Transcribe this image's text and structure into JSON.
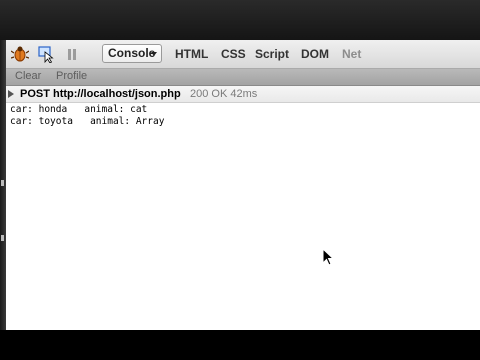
{
  "toolbar": {
    "icons": [
      "firebug-icon",
      "inspect-icon",
      "pause-icon"
    ],
    "console_label": "Console",
    "tabs": [
      {
        "label": "HTML",
        "enabled": true
      },
      {
        "label": "CSS",
        "enabled": true
      },
      {
        "label": "Script",
        "enabled": true
      },
      {
        "label": "DOM",
        "enabled": true
      },
      {
        "label": "Net",
        "enabled": false
      }
    ]
  },
  "subbar": {
    "clear_label": "Clear",
    "profile_label": "Profile"
  },
  "request": {
    "method": "POST",
    "url": "http://localhost/json.php",
    "status": "200 OK 42ms"
  },
  "output": {
    "lines": [
      "car: honda   animal: cat",
      "car: toyota   animal: Array"
    ]
  },
  "colors": {
    "toolbar_bg": "#e4e4e4",
    "subbar_bg": "#adadad",
    "status_text": "#7a7a7a"
  }
}
